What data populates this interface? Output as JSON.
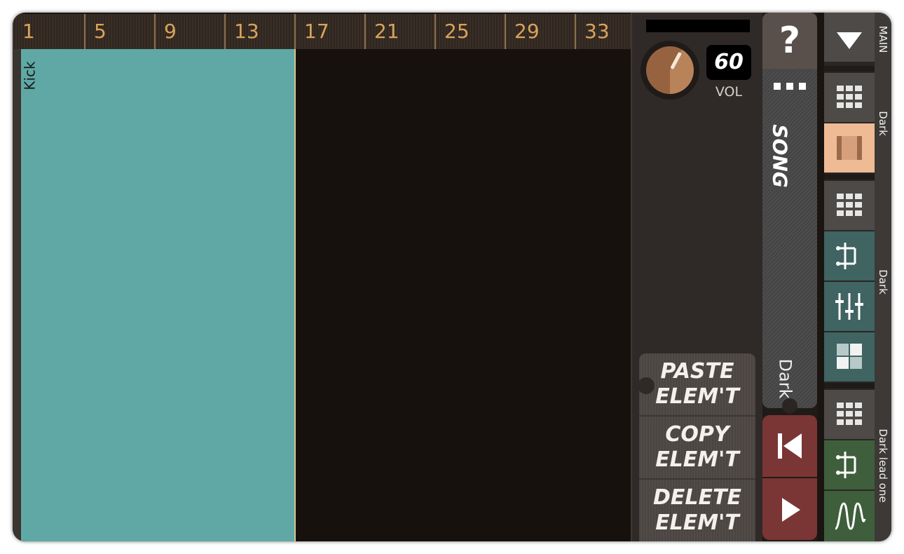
{
  "ruler": {
    "bars": [
      "1",
      "5",
      "9",
      "13",
      "17",
      "21",
      "25",
      "29",
      "33"
    ]
  },
  "track": {
    "name": "Kick"
  },
  "mixer": {
    "volume": "60",
    "volume_label": "VOL"
  },
  "elements": {
    "paste": "PASTE\nELEM'T",
    "copy": "COPY\nELEM'T",
    "delete": "DELETE\nELEM'T",
    "paste_l1": "PASTE",
    "paste_l2": "ELEM'T",
    "copy_l1": "COPY",
    "copy_l2": "ELEM'T",
    "delete_l1": "DELETE",
    "delete_l2": "ELEM'T"
  },
  "song_tab": {
    "help": "?",
    "label": "SONG",
    "pattern": "Dark"
  },
  "instruments": {
    "group_main": "MAIN",
    "group_1": "Dark",
    "group_2": "Dark",
    "group_3": "Dark lead one"
  },
  "colors": {
    "clip": "#5fa8a5",
    "accent": "#d9a35d",
    "selected": "#efbb95",
    "transport": "#7a3535"
  },
  "icons": [
    "dropdown-triangle-icon",
    "pattern-grid-icon",
    "song-bars-icon",
    "effect-routing-icon",
    "mixer-sliders-icon",
    "grid-quadrant-icon",
    "waveform-icon",
    "skip-back-icon",
    "play-icon"
  ]
}
